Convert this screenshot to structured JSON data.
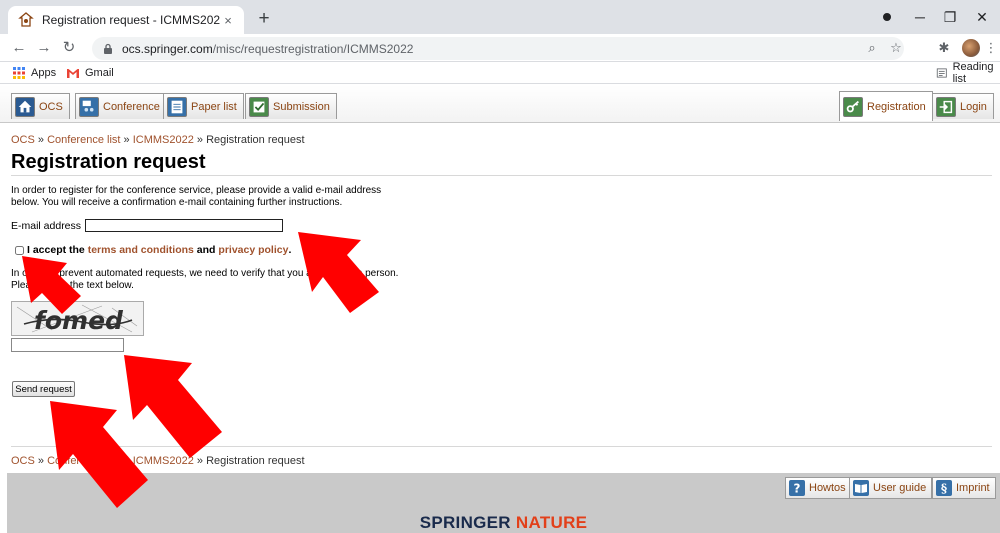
{
  "browser": {
    "tab_title": "Registration request - ICMMS2022",
    "tab_close": "×",
    "new_tab": "+",
    "url_host": "ocs.springer.com",
    "url_path": "/misc/requestregistration/ICMMS2022",
    "bookmarks": {
      "apps": "Apps",
      "gmail": "Gmail",
      "reading_list": "Reading list"
    }
  },
  "nav": {
    "ocs": "OCS",
    "conference": "Conference",
    "paper_list": "Paper list",
    "submission": "Submission",
    "registration": "Registration",
    "login": "Login"
  },
  "breadcrumb": {
    "ocs": "OCS",
    "sep": " » ",
    "conference_list": "Conference list",
    "conference": "ICMMS2022",
    "current": "Registration request"
  },
  "page": {
    "title": "Registration request",
    "intro_line1": "In order to register for the conference service, please provide a valid e-mail address",
    "intro_line2": "below. You will receive a confirmation e-mail containing further instructions.",
    "email_label": "E-mail address",
    "email_value": "",
    "accept_prefix": "I accept the ",
    "terms_link": "terms and conditions",
    "accept_and": " and ",
    "privacy_link": "privacy policy",
    "accept_suffix": ".",
    "captcha_line1": "In order to prevent automated requests, we need to verify that you are a human person.",
    "captcha_line2": "Please enter the text below.",
    "captcha_word": "fomed",
    "captcha_value": "",
    "send_button": "Send request"
  },
  "footer": {
    "howtos": "Howtos",
    "user_guide": "User guide",
    "imprint": "Imprint",
    "brand_springer": "SPRINGER",
    "brand_nature": "NATURE"
  },
  "colors": {
    "link": "#a0522d",
    "annotation_arrow": "#ff0000",
    "brand_navy": "#1a2b4c",
    "brand_orange": "#e2401a"
  }
}
